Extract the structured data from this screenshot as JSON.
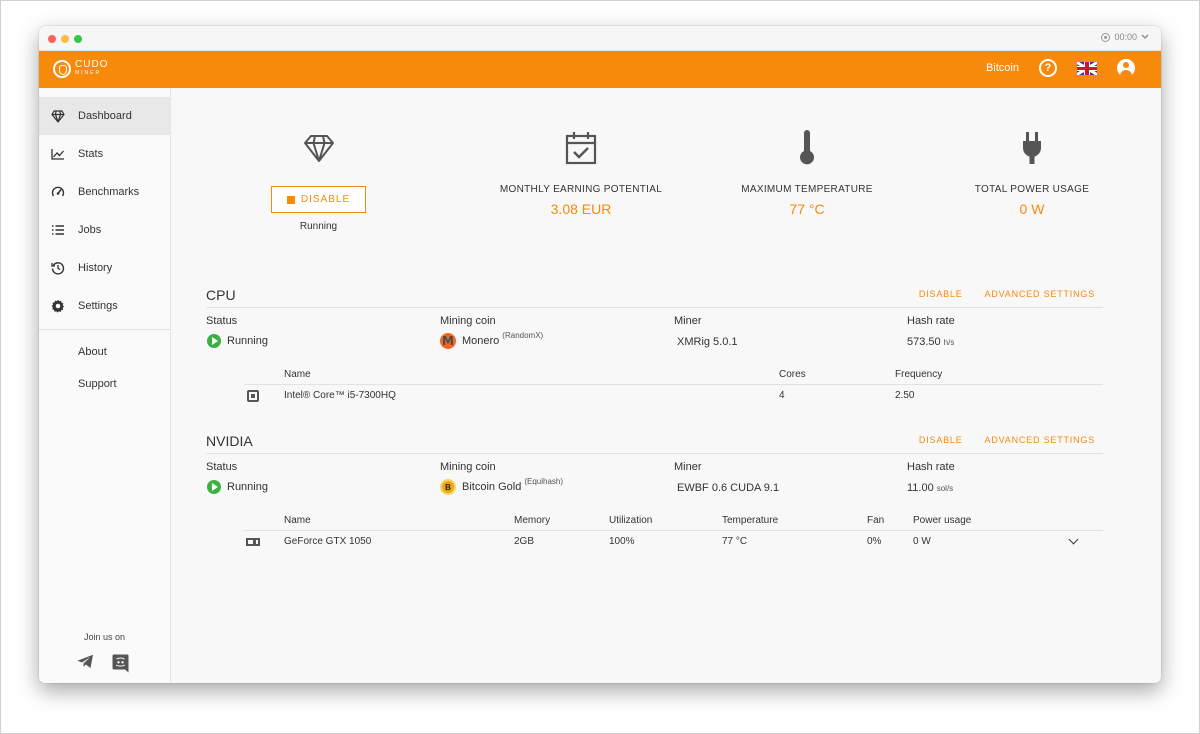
{
  "titlebar": {
    "timer": "00:00"
  },
  "header": {
    "logo_text": "CUDO",
    "logo_sub": "MINER",
    "coin_link": "Bitcoin",
    "help_symbol": "?"
  },
  "sidebar": {
    "items": [
      {
        "label": "Dashboard",
        "icon": "diamond-icon",
        "active": true
      },
      {
        "label": "Stats",
        "icon": "line-chart-icon"
      },
      {
        "label": "Benchmarks",
        "icon": "speedometer-icon"
      },
      {
        "label": "Jobs",
        "icon": "list-icon"
      },
      {
        "label": "History",
        "icon": "history-icon"
      },
      {
        "label": "Settings",
        "icon": "gear-icon"
      }
    ],
    "links": [
      "About",
      "Support"
    ],
    "join_label": "Join us on",
    "social": [
      "telegram-icon",
      "discord-icon"
    ]
  },
  "dashboard": {
    "disable_label": "DISABLE",
    "running_label": "Running",
    "monthly": {
      "label": "MONTHLY EARNING POTENTIAL",
      "value": "3.08 EUR"
    },
    "temperature": {
      "label": "MAXIMUM TEMPERATURE",
      "value": "77 °C"
    },
    "power": {
      "label": "TOTAL POWER USAGE",
      "value": "0 W"
    }
  },
  "cpu": {
    "title": "CPU",
    "actions": {
      "disable": "DISABLE",
      "advanced": "ADVANCED SETTINGS"
    },
    "labels": {
      "status": "Status",
      "coin": "Mining coin",
      "miner": "Miner",
      "hash": "Hash rate"
    },
    "values": {
      "status": "Running",
      "coin": "Monero",
      "algo": "(RandomX)",
      "miner": "XMRig 5.0.1",
      "hash": "573.50",
      "hash_unit": "h/s"
    },
    "table": {
      "headers": [
        "Name",
        "Cores",
        "Frequency"
      ],
      "rows": [
        {
          "name": "Intel® Core™ i5-7300HQ",
          "cores": "4",
          "frequency": "2.50"
        }
      ]
    }
  },
  "nvidia": {
    "title": "NVIDIA",
    "actions": {
      "disable": "DISABLE",
      "advanced": "ADVANCED SETTINGS"
    },
    "labels": {
      "status": "Status",
      "coin": "Mining coin",
      "miner": "Miner",
      "hash": "Hash rate"
    },
    "values": {
      "status": "Running",
      "coin": "Bitcoin Gold",
      "algo": "(Equihash)",
      "miner": "EWBF 0.6 CUDA 9.1",
      "hash": "11.00",
      "hash_unit": "sol/s"
    },
    "table": {
      "headers": [
        "Name",
        "Memory",
        "Utilization",
        "Temperature",
        "Fan",
        "Power usage"
      ],
      "rows": [
        {
          "name": "GeForce GTX 1050",
          "memory": "2GB",
          "utilization": "100%",
          "temperature": "77 °C",
          "fan": "0%",
          "power": "0 W"
        }
      ]
    }
  },
  "colors": {
    "accent": "#f7890b",
    "running": "#3cb043",
    "monero": "#f26822",
    "bitcoin_gold": "#eba809"
  }
}
